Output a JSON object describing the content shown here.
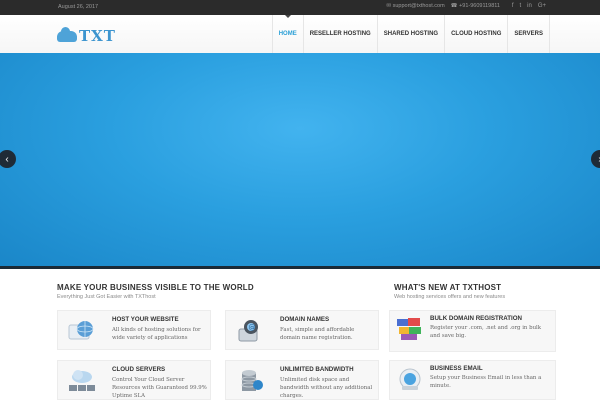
{
  "topbar": {
    "date": "August 26, 2017",
    "email": "support@txthost.com",
    "phone": "+91-9609119811",
    "social": [
      "f",
      "t",
      "in",
      "G+"
    ]
  },
  "header": {
    "logo_text": "TXT",
    "nav": [
      {
        "label": "HOME",
        "active": true
      },
      {
        "label": "RESELLER HOSTING",
        "active": false
      },
      {
        "label": "SHARED HOSTING",
        "active": false
      },
      {
        "label": "CLOUD HOSTING",
        "active": false
      },
      {
        "label": "SERVERS",
        "active": false
      }
    ]
  },
  "slider": {
    "prev_icon": "chevron-left-icon",
    "next_icon": "chevron-right-icon"
  },
  "business": {
    "title": "MAKE YOUR BUSINESS VISIBLE TO THE WORLD",
    "subtitle": "Everything Just Got Easier with TXThost",
    "cards": [
      {
        "title": "HOST YOUR WEBSITE",
        "desc": "All kinds of hosting solutions for wide variety of applications",
        "icon": "globe-icon"
      },
      {
        "title": "DOMAIN NAMES",
        "desc": "Fast, simple and affordable domain name registration.",
        "icon": "domain-icon"
      },
      {
        "title": "CLOUD SERVERS",
        "desc": "Control Your Cloud Server Resources with Guaranteed 99.9% Uptime SLA",
        "icon": "cloud-server-icon"
      },
      {
        "title": "UNLIMITED BANDWIDTH",
        "desc": "Unlimited disk space and bandwidth without any additional charges.",
        "icon": "database-icon"
      }
    ]
  },
  "news": {
    "title": "WHAT'S NEW AT TXTHOST",
    "subtitle": "Web hosting services offers and new features",
    "items": [
      {
        "title": "BULK DOMAIN REGISTRATION",
        "desc": "Register your .com, .net and .org in bulk and save big.",
        "icon": "bulk-domain-icon"
      },
      {
        "title": "BUSINESS EMAIL",
        "desc": "Setup your Business Email in less than a minute.",
        "icon": "email-icon"
      }
    ]
  },
  "colors": {
    "accent": "#2a9fd6",
    "slider": "#2a9fdf",
    "topbar": "#2b2b2b"
  }
}
